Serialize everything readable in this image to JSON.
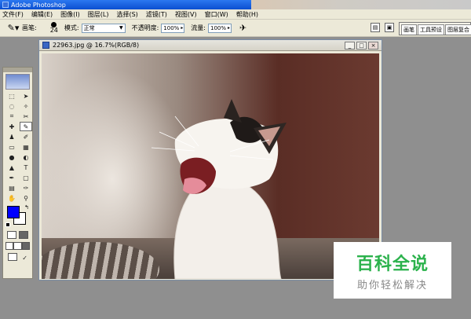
{
  "app": {
    "title": "Adobe Photoshop"
  },
  "menu": [
    "文件(F)",
    "编辑(E)",
    "图像(I)",
    "图层(L)",
    "选择(S)",
    "滤镜(T)",
    "视图(V)",
    "窗口(W)",
    "帮助(H)"
  ],
  "options": {
    "brush_label": "画笔:",
    "brush_size": "24",
    "mode_label": "模式:",
    "mode_value": "正常",
    "opacity_label": "不透明度:",
    "opacity_value": "100%",
    "flow_label": "流量:",
    "flow_value": "100%"
  },
  "palette_tabs": [
    "画笔",
    "工具预设",
    "图层复合"
  ],
  "document": {
    "title": "22963.jpg @ 16.7%(RGB/8)"
  },
  "colors": {
    "foreground": "#0000ff",
    "background": "#ffffff"
  },
  "watermark": {
    "main": "百科全说",
    "sub": "助你轻松解决"
  }
}
